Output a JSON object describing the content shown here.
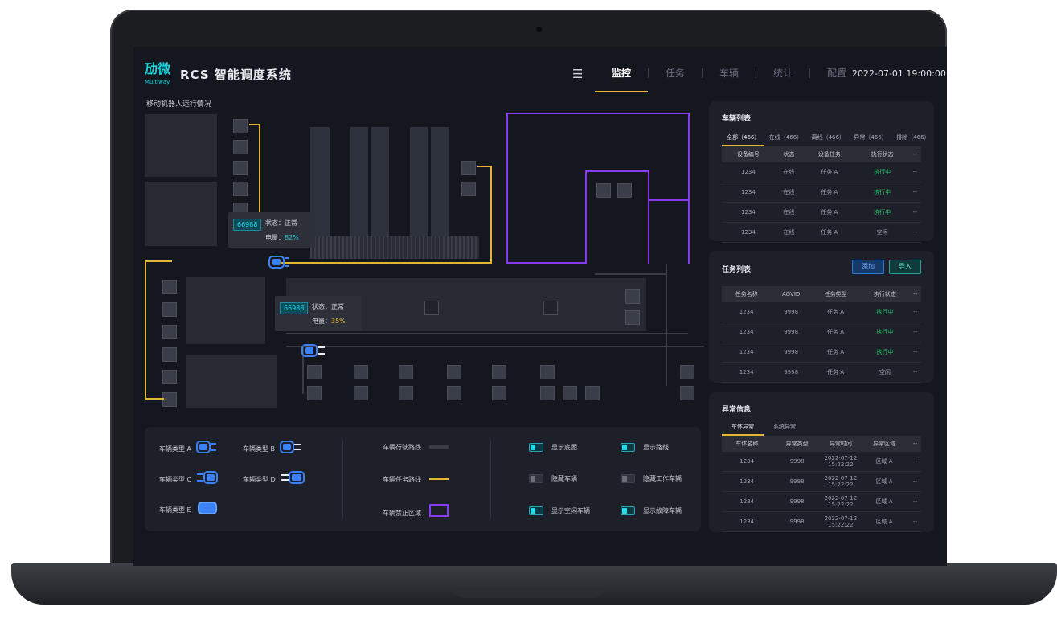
{
  "app": {
    "logo_text": "劢微",
    "logo_sub": "Multiway",
    "title": "RCS  智能调度系统",
    "datetime": "2022-07-01  19:00:00"
  },
  "nav": {
    "menu_icon": "menu-icon",
    "tabs": [
      {
        "label": "监控",
        "active": true
      },
      {
        "label": "任务",
        "active": false
      },
      {
        "label": "车辆",
        "active": false
      },
      {
        "label": "统计",
        "active": false
      },
      {
        "label": "配置",
        "active": false
      }
    ]
  },
  "map": {
    "title": "移动机器人运行情况",
    "tooltips": [
      {
        "id": "66988",
        "status_label": "状态：",
        "status": "正常",
        "battery_label": "电量：",
        "battery": "82%",
        "battery_color": "#1fc6d6"
      },
      {
        "id": "66988",
        "status_label": "状态：",
        "status": "正常",
        "battery_label": "电量：",
        "battery": "35%",
        "battery_color": "#e5b72e"
      }
    ]
  },
  "legend": {
    "vehicles": [
      "车辆类型 A",
      "车辆类型 B",
      "车辆类型 C",
      "车辆类型 D",
      "车辆类型 E"
    ],
    "routes": [
      "车辆行驶路线",
      "车辆任务路线",
      "车辆禁止区域"
    ],
    "toggles": [
      {
        "label": "显示底图",
        "on": true
      },
      {
        "label": "显示路线",
        "on": true
      },
      {
        "label": "隐藏车辆",
        "on": false
      },
      {
        "label": "隐藏工作车辆",
        "on": false
      },
      {
        "label": "显示空闲车辆",
        "on": true
      },
      {
        "label": "显示故障车辆",
        "on": true
      }
    ],
    "colors": {
      "route": "#3a3d45",
      "task_route": "#e5b72e",
      "forbidden": "#8a3bf0"
    }
  },
  "vehicle_list": {
    "title": "车辆列表",
    "tabs": [
      "全部（466）",
      "在线（466）",
      "离线（466）",
      "异常（466）",
      "排除（466）"
    ],
    "headers": [
      "设备编号",
      "状态",
      "设备任务",
      "执行状态",
      "--"
    ],
    "rows": [
      [
        "1234",
        "在线",
        "任务 A",
        "执行中",
        "--"
      ],
      [
        "1234",
        "在线",
        "任务 A",
        "执行中",
        "--"
      ],
      [
        "1234",
        "在线",
        "任务 A",
        "执行中",
        "--"
      ],
      [
        "1234",
        "在线",
        "任务 A",
        "空闲",
        "--"
      ]
    ]
  },
  "task_list": {
    "title": "任务列表",
    "add_label": "添加",
    "import_label": "导入",
    "headers": [
      "任务名称",
      "AGVID",
      "任务类型",
      "执行状态",
      "--"
    ],
    "rows": [
      [
        "1234",
        "9998",
        "任务 A",
        "执行中",
        "--"
      ],
      [
        "1234",
        "9998",
        "任务 A",
        "执行中",
        "--"
      ],
      [
        "1234",
        "9998",
        "任务 A",
        "执行中",
        "--"
      ],
      [
        "1234",
        "9998",
        "任务 A",
        "空闲",
        "--"
      ]
    ]
  },
  "exceptions": {
    "title": "异常信息",
    "tabs": [
      "车体异常",
      "系统异常"
    ],
    "headers": [
      "车体名称",
      "异常类型",
      "异常时间",
      "异常区域",
      "--"
    ],
    "rows": [
      [
        "1234",
        "9998",
        "2022-07-12 15:22:22",
        "区域 A",
        "--"
      ],
      [
        "1234",
        "9998",
        "2022-07-12 15:22:22",
        "区域 A",
        "--"
      ],
      [
        "1234",
        "9998",
        "2022-07-12 15:22:22",
        "区域 A",
        "--"
      ],
      [
        "1234",
        "9998",
        "2022-07-12 15:22:22",
        "区域 A",
        "--"
      ]
    ]
  }
}
